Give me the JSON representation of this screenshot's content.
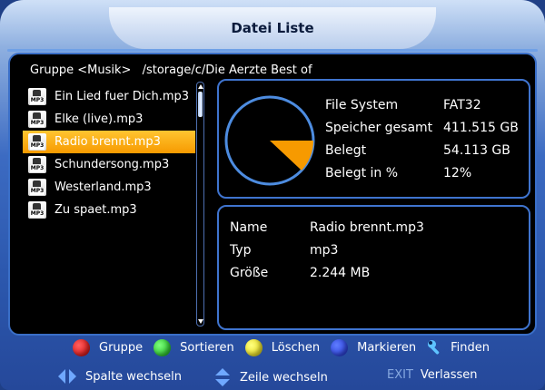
{
  "window": {
    "title": "Datei Liste"
  },
  "path": {
    "group": "Gruppe <Musik>",
    "location": "/storage/c/Die Aerzte Best of"
  },
  "files": [
    {
      "name": "Ein Lied fuer Dich.mp3",
      "icon_text": "MP3",
      "selected": false
    },
    {
      "name": "Elke (live).mp3",
      "icon_text": "MP3",
      "selected": false
    },
    {
      "name": "Radio brennt.mp3",
      "icon_text": "MP3",
      "selected": true
    },
    {
      "name": "Schundersong.mp3",
      "icon_text": "MP3",
      "selected": false
    },
    {
      "name": "Westerland.mp3",
      "icon_text": "MP3",
      "selected": false
    },
    {
      "name": "Zu spaet.mp3",
      "icon_text": "MP3",
      "selected": false
    }
  ],
  "storage": {
    "used_fraction": 0.12,
    "pie_color": "#f79a00",
    "ring_color": "#4d8ce0",
    "rows": [
      {
        "label": "File System",
        "value": "FAT32"
      },
      {
        "label": "Speicher gesamt",
        "value": "411.515 GB"
      },
      {
        "label": "Belegt",
        "value": "54.113 GB"
      },
      {
        "label": "Belegt in %",
        "value": "12%"
      }
    ]
  },
  "details": [
    {
      "label": "Name",
      "value": "Radio brennt.mp3"
    },
    {
      "label": "Typ",
      "value": "mp3"
    },
    {
      "label": "Größe",
      "value": "2.244 MB"
    }
  ],
  "color_buttons": {
    "red": "Gruppe",
    "green": "Sortieren",
    "yellow": "Löschen",
    "blue": "Markieren",
    "find": "Finden"
  },
  "navigation": {
    "column": "Spalte wechseln",
    "row": "Zeile wechseln",
    "exit_key": "EXIT",
    "exit_label": "Verlassen"
  },
  "colors": {
    "accent": "#f79a00",
    "frame_blue": "#2c58ae",
    "border_blue": "#3f74cf"
  }
}
